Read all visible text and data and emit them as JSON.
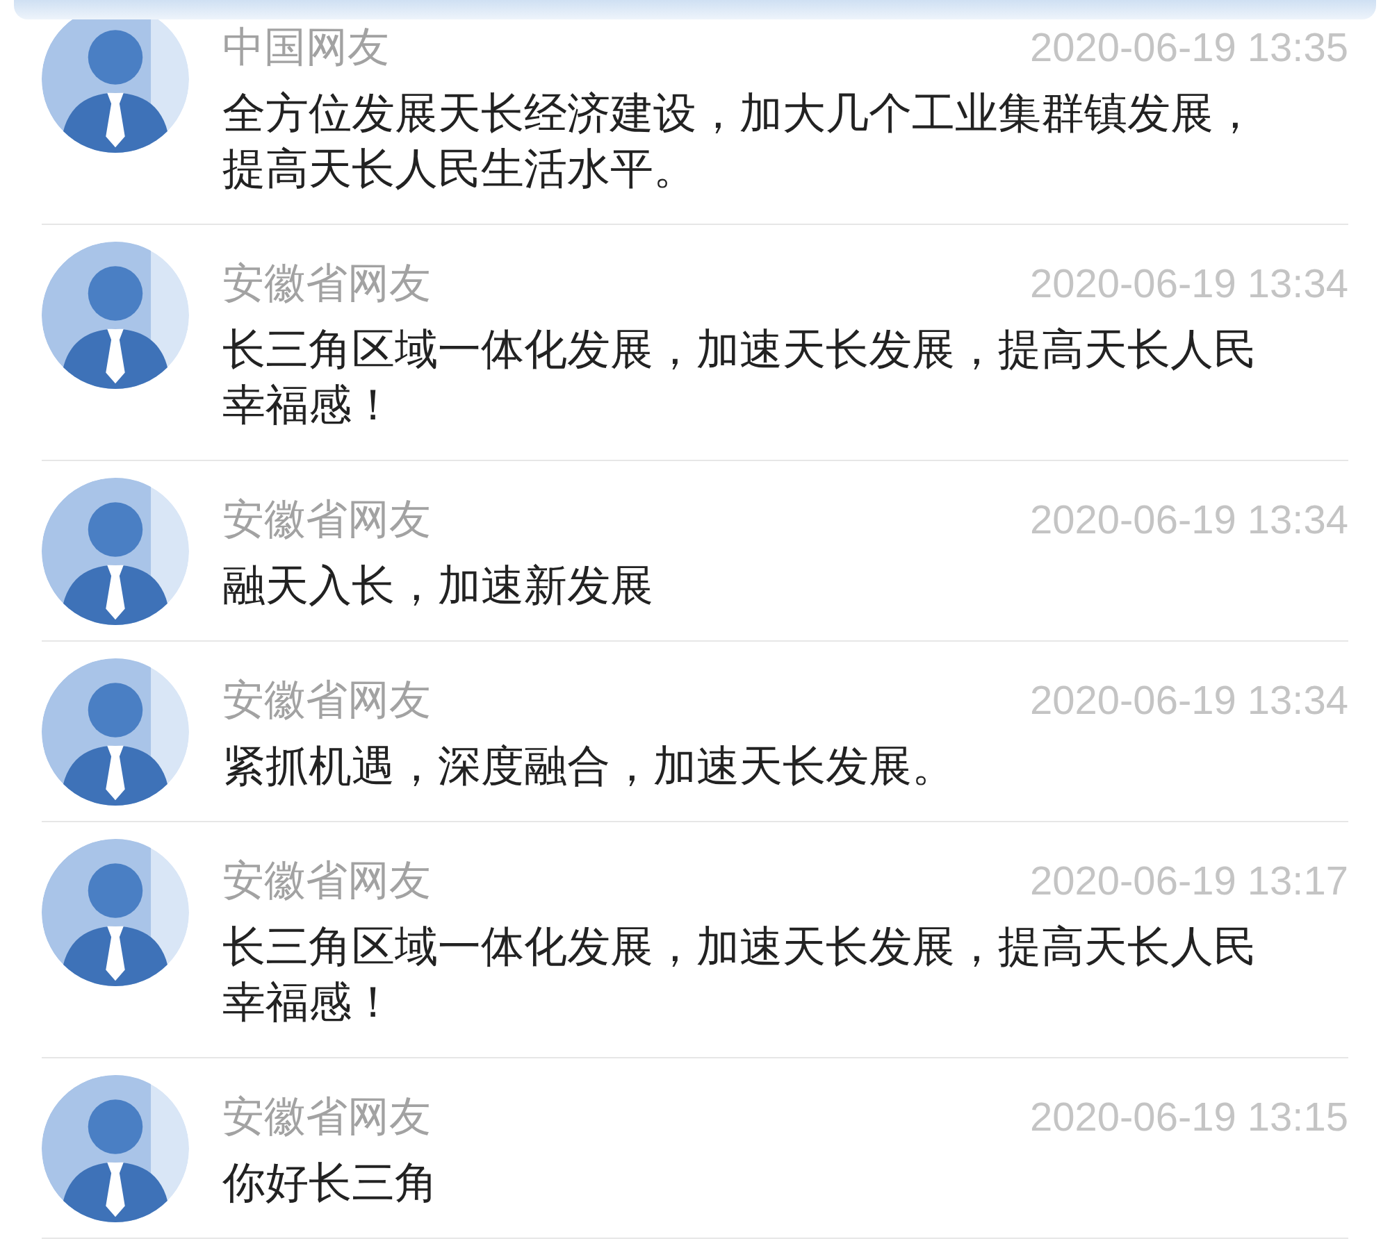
{
  "comments": [
    {
      "user": "中国网友",
      "time": "2020-06-19 13:35",
      "text": "全方位发展天长经济建设，加大几个工业集群镇发展，提高天长人民生活水平。"
    },
    {
      "user": "安徽省网友",
      "time": "2020-06-19 13:34",
      "text": "长三角区域一体化发展，加速天长发展，提高天长人民幸福感！"
    },
    {
      "user": "安徽省网友",
      "time": "2020-06-19 13:34",
      "text": "融天入长，加速新发展"
    },
    {
      "user": "安徽省网友",
      "time": "2020-06-19 13:34",
      "text": "紧抓机遇，深度融合，加速天长发展。"
    },
    {
      "user": "安徽省网友",
      "time": "2020-06-19 13:17",
      "text": "长三角区域一体化发展，加速天长发展，提高天长人民幸福感！"
    },
    {
      "user": "安徽省网友",
      "time": "2020-06-19 13:15",
      "text": "你好长三角"
    }
  ]
}
